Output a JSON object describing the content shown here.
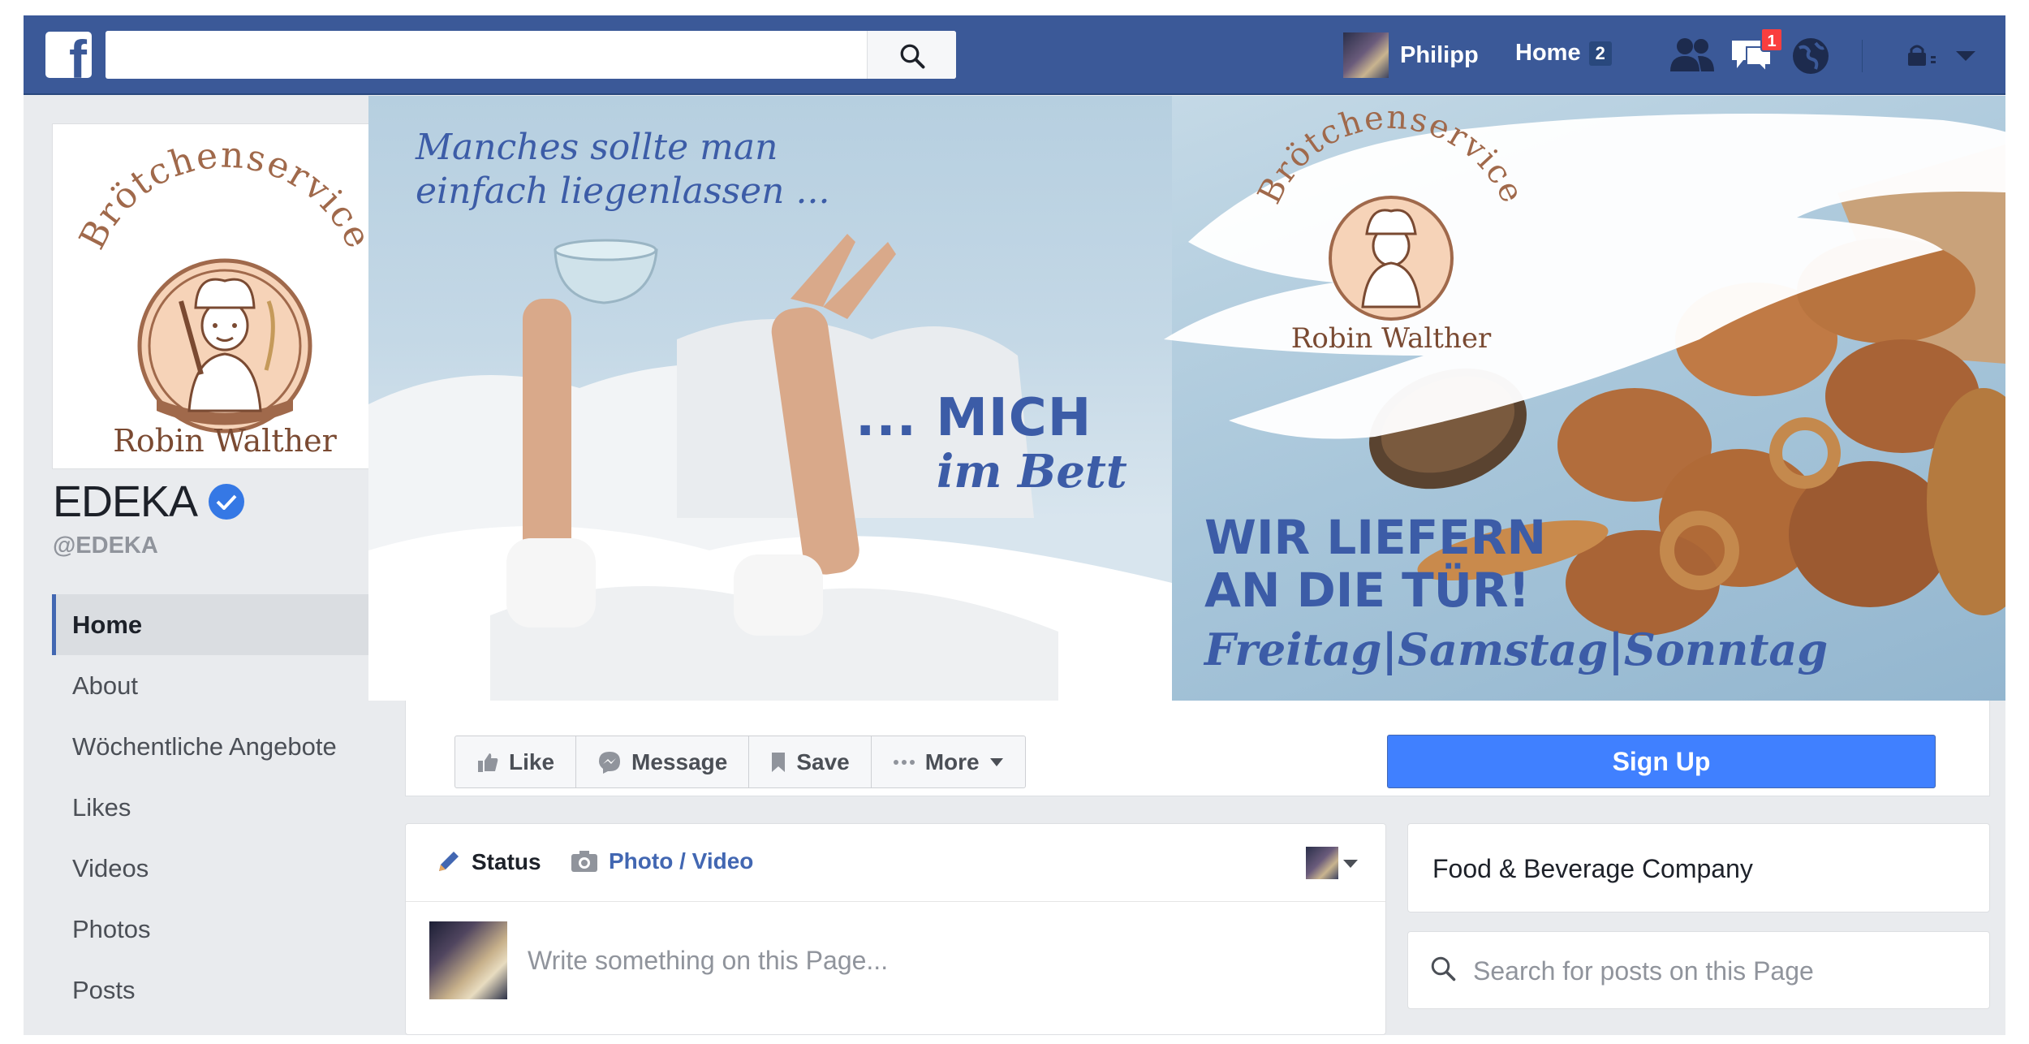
{
  "topbar": {
    "user_name": "Philipp",
    "home_label": "Home",
    "home_count": "2",
    "notification_count": "1"
  },
  "page": {
    "name": "EDEKA",
    "handle": "@EDEKA"
  },
  "nav": {
    "items": [
      {
        "label": "Home",
        "active": true
      },
      {
        "label": "About"
      },
      {
        "label": "Wöchentliche Angebote"
      },
      {
        "label": "Likes"
      },
      {
        "label": "Videos"
      },
      {
        "label": "Photos"
      },
      {
        "label": "Posts"
      }
    ]
  },
  "logo": {
    "arc_text": "Brötchenservice",
    "name": "Robin Walther",
    "brand_color": "#a0694b"
  },
  "cover": {
    "line1": "Manches sollte man",
    "line2": "einfach liegenlassen ...",
    "mich": "... MICH",
    "bett": "im Bett",
    "liefern1": "WIR LIEFERN",
    "liefern2": "AN DIE TÜR!",
    "days": "Freitag|Samstag|Sonntag",
    "text_color": "#3c5ca7"
  },
  "actions": {
    "like": "Like",
    "message": "Message",
    "save": "Save",
    "more": "More",
    "signup": "Sign Up"
  },
  "composer": {
    "status_tab": "Status",
    "photo_tab": "Photo / Video",
    "placeholder": "Write something on this Page..."
  },
  "sidebar": {
    "category": "Food & Beverage Company",
    "search_placeholder": "Search for posts on this Page"
  },
  "colors": {
    "facebook_blue": "#3b5998",
    "signup_blue": "#4080ff"
  }
}
